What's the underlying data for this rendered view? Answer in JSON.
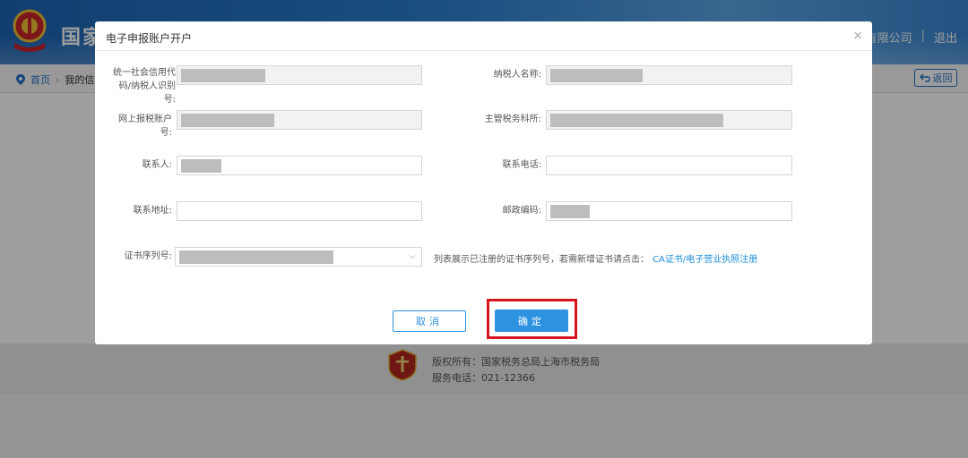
{
  "header": {
    "site_title": "国家",
    "company_suffix": "有限公司",
    "separator": "|",
    "logout": "退出"
  },
  "breadcrumb": {
    "home": "首页",
    "current": "我的信息"
  },
  "back_button": "返回",
  "footer": {
    "copyright": "版权所有：国家税务总局上海市税务局",
    "phone": "服务电话：021-12366"
  },
  "modal": {
    "title": "电子申报账户开户",
    "close": "×",
    "fields": {
      "credit_code_label": "统一社会信用代码/纳税人识别号:",
      "taxpayer_name_label": "纳税人名称:",
      "online_account_label": "网上报税账户号:",
      "tax_office_label": "主管税务科所:",
      "contact_person_label": "联系人:",
      "contact_phone_label": "联系电话:",
      "address_label": "联系地址:",
      "postal_code_label": "邮政编码:",
      "cert_serial_label": "证书序列号:"
    },
    "hint_text": "列表展示已注册的证书序列号，若需新增证书请点击：",
    "hint_link": "CA证书/电子营业执照注册",
    "cancel_button": "取消",
    "confirm_button": "确定"
  },
  "colors": {
    "primary": "#2d92e0",
    "highlight_frame": "#d7151d",
    "header_blue": "#1c64b4"
  }
}
